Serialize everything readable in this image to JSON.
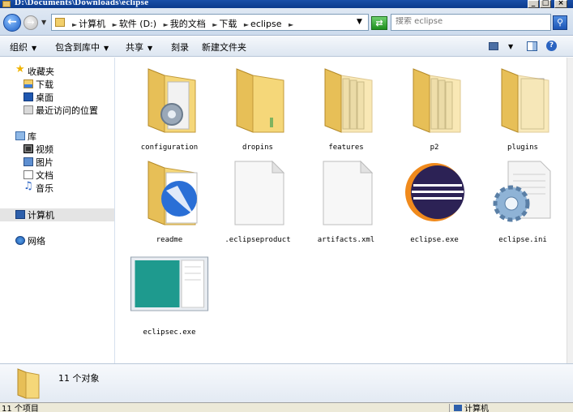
{
  "window": {
    "title": "D:\\Documents\\Downloads\\eclipse",
    "min_label": "_",
    "max_label": "□",
    "close_label": "×"
  },
  "address": {
    "crumbs": [
      "计算机",
      "软件 (D:)",
      "我的文档",
      "下载",
      "eclipse"
    ]
  },
  "search": {
    "placeholder": "搜索 eclipse"
  },
  "toolbar": {
    "organize": "组织",
    "include_library": "包含到库中",
    "share": "共享",
    "burn": "刻录",
    "new_folder": "新建文件夹"
  },
  "nav": {
    "favorites": "收藏夹",
    "downloads": "下载",
    "desktop": "桌面",
    "recent": "最近访问的位置",
    "libraries": "库",
    "videos": "视频",
    "pictures": "图片",
    "documents": "文档",
    "music": "音乐",
    "computer": "计算机",
    "network": "网络"
  },
  "items": [
    {
      "name": "configuration",
      "icon": "folder-gear-icon"
    },
    {
      "name": "dropins",
      "icon": "folder-icon"
    },
    {
      "name": "features",
      "icon": "folder-files-icon"
    },
    {
      "name": "p2",
      "icon": "folder-files-icon"
    },
    {
      "name": "plugins",
      "icon": "folder-page-icon"
    },
    {
      "name": "readme",
      "icon": "folder-document-icon"
    },
    {
      "name": ".eclipseproduct",
      "icon": "blank-file-icon"
    },
    {
      "name": "artifacts.xml",
      "icon": "blank-file-icon"
    },
    {
      "name": "eclipse.exe",
      "icon": "eclipse-logo-icon"
    },
    {
      "name": "eclipse.ini",
      "icon": "settings-file-icon"
    },
    {
      "name": "eclipsec.exe",
      "icon": "application-window-icon"
    }
  ],
  "details": {
    "count": "11 个对象"
  },
  "status": {
    "left": "11 个项目",
    "right": "计算机"
  },
  "colors": {
    "folder": "#f2cf6b",
    "selection": "#e4e4e4",
    "accent": "#1b5ec6"
  }
}
